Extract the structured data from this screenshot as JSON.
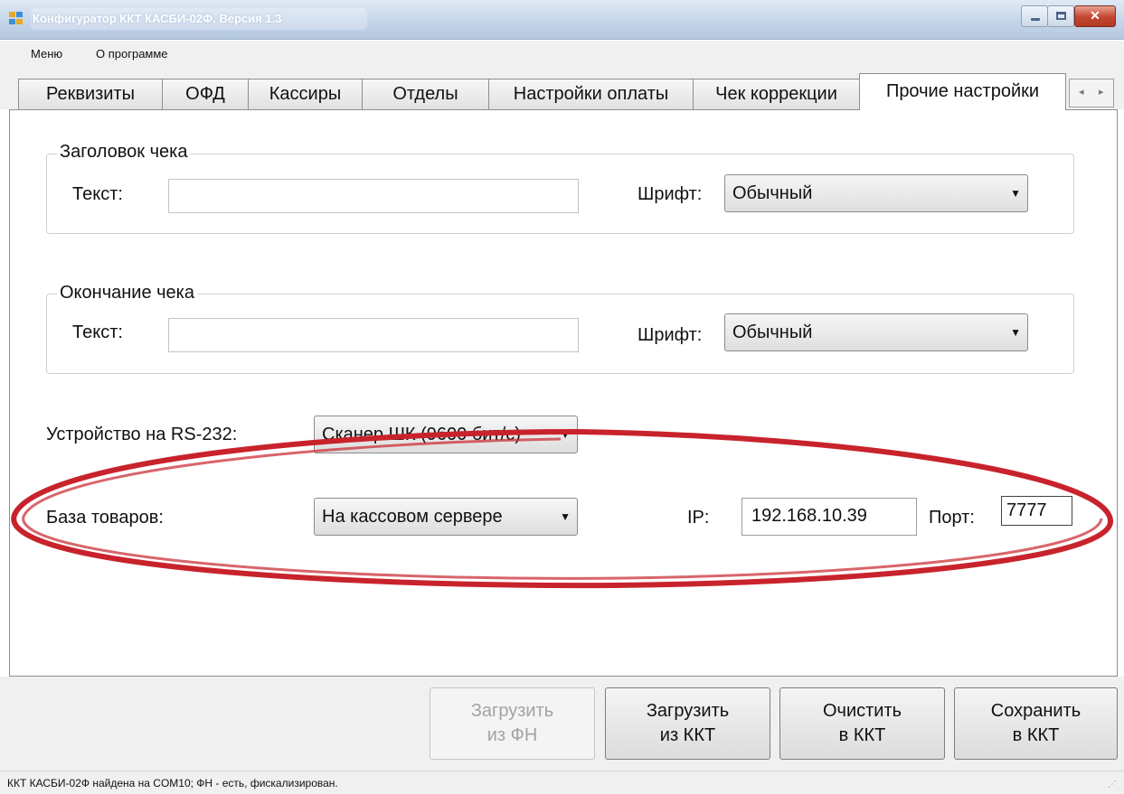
{
  "window": {
    "title": "Конфигуратор ККТ КАСБИ-02Ф. Версия 1.3"
  },
  "menu": {
    "items": [
      "Меню",
      "О программе"
    ]
  },
  "tabs": [
    "Реквизиты",
    "ОФД",
    "Кассиры",
    "Отделы",
    "Настройки оплаты",
    "Чек коррекции",
    "Прочие настройки"
  ],
  "active_tab": "Прочие настройки",
  "header_group": {
    "title": "Заголовок чека",
    "text_label": "Текст:",
    "text_value": "",
    "font_label": "Шрифт:",
    "font_value": "Обычный"
  },
  "footer_group": {
    "title": "Окончание чека",
    "text_label": "Текст:",
    "text_value": "",
    "font_label": "Шрифт:",
    "font_value": "Обычный"
  },
  "rs232": {
    "label": "Устройство на RS-232:",
    "value": "Сканер ШК (9600 бит/с)"
  },
  "goods_db": {
    "label": "База товаров:",
    "value": "На кассовом сервере",
    "ip_label": "IP:",
    "ip_value": "192.168.10.39",
    "port_label": "Порт:",
    "port_value": "7777"
  },
  "buttons": {
    "load_fn": [
      "Загрузить",
      "из ФН"
    ],
    "load_kkt": [
      "Загрузить",
      "из ККТ"
    ],
    "clear_kkt": [
      "Очистить",
      "в ККТ"
    ],
    "save_kkt": [
      "Сохранить",
      "в ККТ"
    ]
  },
  "status": "ККТ КАСБИ-02Ф найдена на COM10; ФН - есть, фискализирован.",
  "colors": {
    "highlight": "#c8232c",
    "title_bar": "#c6d6ea",
    "close_button": "#c4452e"
  }
}
